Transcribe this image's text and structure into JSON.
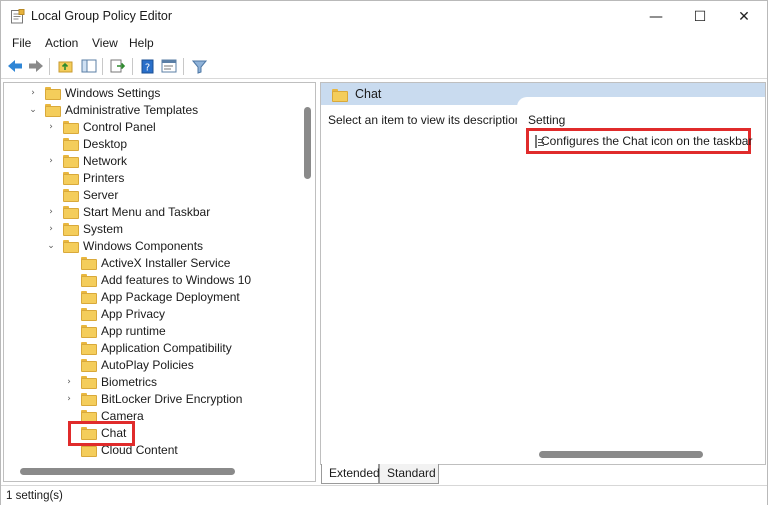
{
  "window": {
    "title": "Local Group Policy Editor",
    "minimize_glyph": "—",
    "maximize_glyph": "☐",
    "close_glyph": "✕"
  },
  "menu": [
    "File",
    "Action",
    "View",
    "Help"
  ],
  "toolbar": {
    "icons": [
      "back-arrow-icon",
      "forward-arrow-icon",
      "up-folder-icon",
      "show-hide-tree-icon",
      "export-list-icon",
      "help-icon",
      "properties-icon",
      "filter-icon"
    ]
  },
  "tree": {
    "items": [
      {
        "label": "Windows Settings",
        "level": 1,
        "chevron": "›"
      },
      {
        "label": "Administrative Templates",
        "level": 1,
        "chevron": "⌄"
      },
      {
        "label": "Control Panel",
        "level": 2,
        "chevron": "›"
      },
      {
        "label": "Desktop",
        "level": 2,
        "chevron": ""
      },
      {
        "label": "Network",
        "level": 2,
        "chevron": "›"
      },
      {
        "label": "Printers",
        "level": 2,
        "chevron": ""
      },
      {
        "label": "Server",
        "level": 2,
        "chevron": ""
      },
      {
        "label": "Start Menu and Taskbar",
        "level": 2,
        "chevron": "›"
      },
      {
        "label": "System",
        "level": 2,
        "chevron": "›"
      },
      {
        "label": "Windows Components",
        "level": 2,
        "chevron": "⌄"
      },
      {
        "label": "ActiveX Installer Service",
        "level": 3,
        "chevron": ""
      },
      {
        "label": "Add features to Windows 10",
        "level": 3,
        "chevron": ""
      },
      {
        "label": "App Package Deployment",
        "level": 3,
        "chevron": ""
      },
      {
        "label": "App Privacy",
        "level": 3,
        "chevron": ""
      },
      {
        "label": "App runtime",
        "level": 3,
        "chevron": ""
      },
      {
        "label": "Application Compatibility",
        "level": 3,
        "chevron": ""
      },
      {
        "label": "AutoPlay Policies",
        "level": 3,
        "chevron": ""
      },
      {
        "label": "Biometrics",
        "level": 3,
        "chevron": "›"
      },
      {
        "label": "BitLocker Drive Encryption",
        "level": 3,
        "chevron": "›"
      },
      {
        "label": "Camera",
        "level": 3,
        "chevron": ""
      },
      {
        "label": "Chat",
        "level": 3,
        "chevron": "",
        "selected": true
      },
      {
        "label": "Cloud Content",
        "level": 3,
        "chevron": ""
      }
    ]
  },
  "right_pane": {
    "header": "Chat",
    "description": "Select an item to view its description.",
    "column_header": "Setting",
    "settings": [
      {
        "label": "Configures the Chat icon on the taskbar"
      }
    ]
  },
  "tabs": [
    "Extended",
    "Standard"
  ],
  "status": "1 setting(s)",
  "colors": {
    "highlight_border": "#e02b2b",
    "header_bg": "#c9dbef",
    "folder": "#f4cd5b"
  }
}
